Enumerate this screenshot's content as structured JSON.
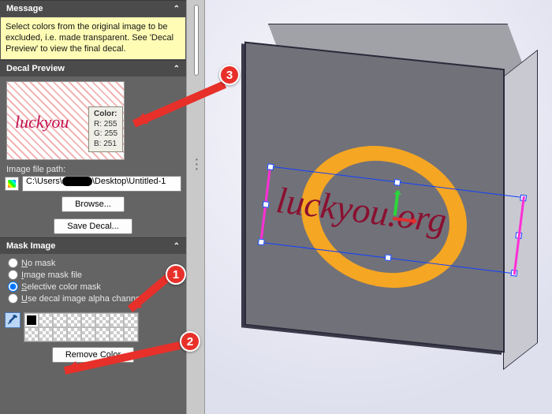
{
  "sections": {
    "message": {
      "title": "Message",
      "body": "Select colors from the original image to be excluded, i.e. made transparent. See 'Decal Preview' to view the final decal."
    },
    "preview": {
      "title": "Decal Preview"
    },
    "mask": {
      "title": "Mask Image"
    }
  },
  "preview": {
    "text": "luckyou",
    "tooltip": {
      "label": "Color:",
      "r": "R: 255",
      "g": "G: 255",
      "b": "B: 251"
    }
  },
  "filepath": {
    "label": "Image file path:",
    "prefix": "C:\\Users\\",
    "suffix": "\\Desktop\\Untitled-1"
  },
  "buttons": {
    "browse": "Browse...",
    "saveDecal": "Save Decal...",
    "removeColor": "Remove Color"
  },
  "mask_options": {
    "none": "No mask",
    "none_u": "N",
    "file": "Image mask file",
    "file_u": "I",
    "selective": "Selective color mask",
    "selective_u": "S",
    "alpha": "Use decal image alpha channel",
    "alpha_u": "U"
  },
  "decal": {
    "text": "luckyou.org"
  },
  "callouts": {
    "c1": "1",
    "c2": "2",
    "c3": "3"
  }
}
